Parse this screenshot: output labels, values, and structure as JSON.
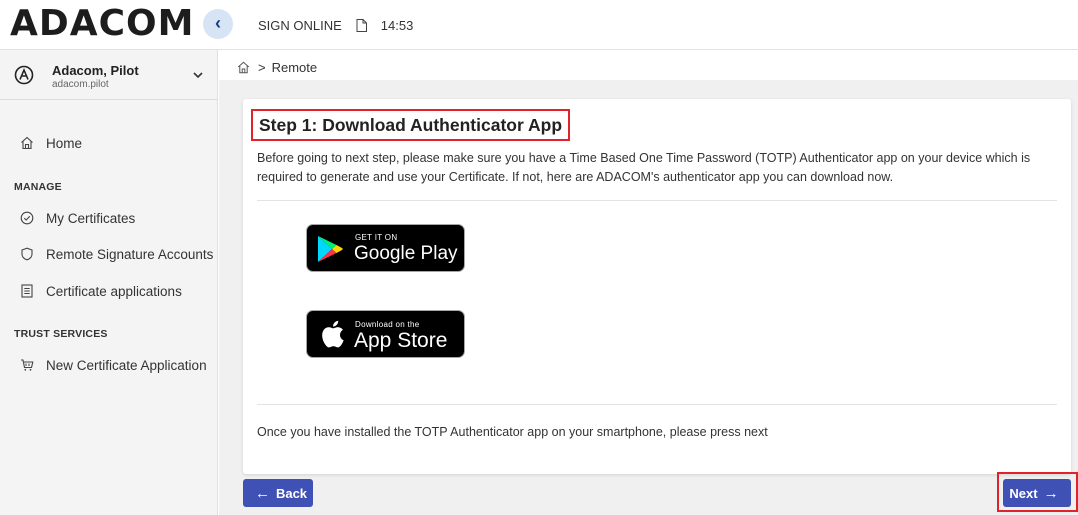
{
  "header": {
    "logo": "ADACOM",
    "collapse_icon": "chevron-left-icon",
    "app_name": "SIGN ONLINE",
    "doc_icon": "document-icon",
    "time": "14:53"
  },
  "user": {
    "name": "Adacom, Pilot",
    "username": "adacom.pilot",
    "avatar_icon": "user-circle-icon",
    "chevron_icon": "chevron-down-icon"
  },
  "sidebar": {
    "home": {
      "label": "Home",
      "icon": "home-icon"
    },
    "manage_title": "MANAGE",
    "manage_items": [
      {
        "label": "My Certificates",
        "icon": "check-circle-icon"
      },
      {
        "label": "Remote Signature Accounts",
        "icon": "shield-icon"
      },
      {
        "label": "Certificate applications",
        "icon": "document-list-icon"
      }
    ],
    "trust_title": "TRUST SERVICES",
    "trust_items": [
      {
        "label": "New Certificate Application",
        "icon": "cart-icon"
      }
    ]
  },
  "breadcrumb": {
    "home_icon": "home-icon",
    "separator": ">",
    "current": "Remote"
  },
  "step": {
    "title": "Step 1: Download Authenticator App",
    "description": "Before going to next step, please make sure you have a Time Based One Time Password (TOTP) Authenticator app on your device which is required to generate and use your Certificate. If not, here are ADACOM's authenticator app you can download now.",
    "google_play": {
      "small": "GET IT ON",
      "big": "Google Play"
    },
    "app_store": {
      "small": "Download on the",
      "big": "App Store"
    },
    "footer_text": "Once you have installed the TOTP Authenticator app on your smartphone, please press next"
  },
  "actions": {
    "back_label": "Back",
    "back_icon": "arrow-left-icon",
    "next_label": "Next",
    "next_icon": "arrow-right-icon"
  },
  "colors": {
    "primary": "#3f51b5",
    "highlight": "#e0232a"
  }
}
